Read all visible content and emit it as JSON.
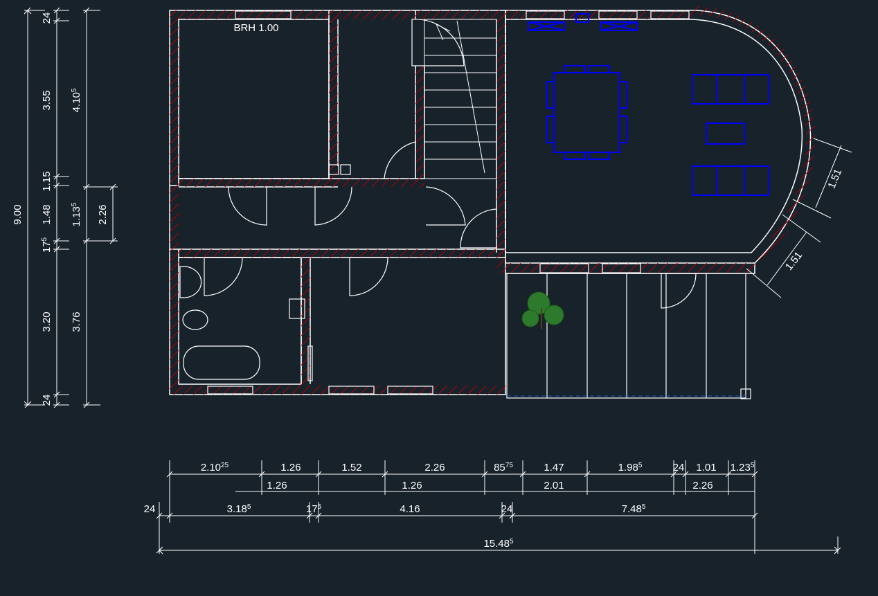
{
  "drawing": {
    "overall_width": "15.48",
    "overall_height": "9.00",
    "room_label": "BRH 1.00",
    "dims_vert_outer": [
      {
        "val": "24",
        "sup": ""
      },
      {
        "val": "3.55",
        "sup": ""
      },
      {
        "val": "1.15",
        "sup": ""
      },
      {
        "val": "1.48",
        "sup": ""
      },
      {
        "val": "17",
        "sup": "5"
      },
      {
        "val": "3.20",
        "sup": ""
      },
      {
        "val": "24",
        "sup": ""
      }
    ],
    "dims_vert_mid": [
      {
        "val": "4.10",
        "sup": "5"
      },
      {
        "val": "1.13",
        "sup": "5"
      },
      {
        "val": "2.26",
        "sup": ""
      },
      {
        "val": "3.76",
        "sup": ""
      }
    ],
    "dims_horiz_row1": [
      {
        "val": "2.10",
        "sup": "25"
      },
      {
        "val": "1.26",
        "sup": ""
      },
      {
        "val": "1.52",
        "sup": ""
      },
      {
        "val": "2.26",
        "sup": ""
      },
      {
        "val": "85",
        "sup": "75"
      },
      {
        "val": "1.47",
        "sup": ""
      },
      {
        "val": "1.98",
        "sup": "5"
      },
      {
        "val": "24",
        "sup": ""
      },
      {
        "val": "1.01",
        "sup": ""
      },
      {
        "val": "1.23",
        "sup": "5"
      }
    ],
    "dims_horiz_row2": [
      {
        "val": "1.26",
        "sup": ""
      },
      {
        "val": "1.26",
        "sup": ""
      },
      {
        "val": "2.01",
        "sup": ""
      },
      {
        "val": "2.26",
        "sup": ""
      }
    ],
    "dims_horiz_row3": [
      {
        "val": "24",
        "sup": ""
      },
      {
        "val": "3.18",
        "sup": "5"
      },
      {
        "val": "17",
        "sup": "5"
      },
      {
        "val": "4.16",
        "sup": ""
      },
      {
        "val": "24",
        "sup": ""
      },
      {
        "val": "7.48",
        "sup": "5"
      }
    ],
    "dims_diag": [
      {
        "val": "1.51"
      },
      {
        "val": "1.51"
      }
    ]
  }
}
